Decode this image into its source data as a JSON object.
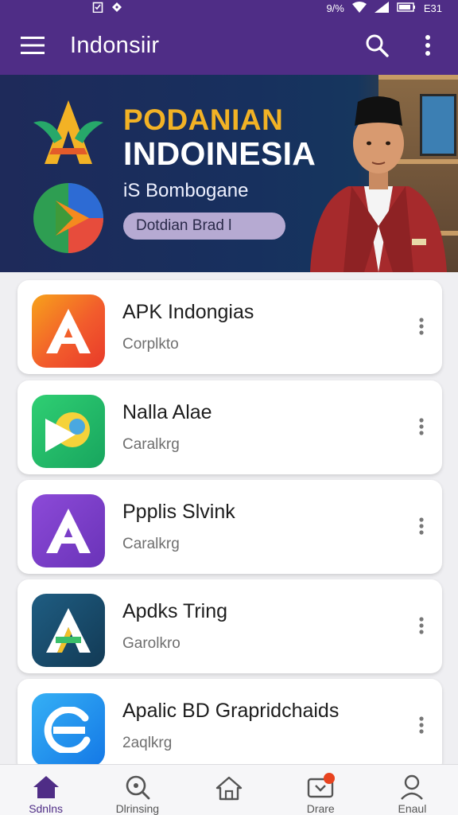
{
  "status_bar": {
    "left_icons": [
      "clipboard-icon",
      "tag-icon"
    ],
    "battery_text": "9/%",
    "time": "E31"
  },
  "app_bar": {
    "title": "Indonsiir",
    "icons": [
      "menu-icon",
      "search-icon",
      "more-vertical-icon"
    ]
  },
  "banner": {
    "heading_1": "PODANIAN",
    "heading_2": "INDOINESIA",
    "subtitle": "iS Bombogane",
    "cta_label": "Dotdian Brad l",
    "colors": {
      "heading_accent": "#f2b225",
      "background": "#1e2a5a"
    }
  },
  "apps": [
    {
      "title": "APK Indongias",
      "subtitle": "Corplkto",
      "icon": "letter-a-icon",
      "color": "#f25c2c"
    },
    {
      "title": "Nalla Alae",
      "subtitle": "Caralkrg",
      "icon": "play-leaf-icon",
      "color": "#1fb46a"
    },
    {
      "title": "Ppplis Slvink",
      "subtitle": "Caralkrg",
      "icon": "letter-a-icon",
      "color": "#7b3fc4"
    },
    {
      "title": "Apdks Tring",
      "subtitle": "Garolkro",
      "icon": "letter-a-icon",
      "color": "#1b4a6b"
    },
    {
      "title": "Apalic BD Grapridchaids",
      "subtitle": "2aqlkrg",
      "icon": "letter-e-icon",
      "color": "#1f8ef0"
    }
  ],
  "bottom_nav": [
    {
      "label": "Sdnlns",
      "icon": "home-filled-icon",
      "active": true
    },
    {
      "label": "Dlrinsing",
      "icon": "search-icon",
      "active": false
    },
    {
      "label": "",
      "icon": "home-outline-icon",
      "active": false
    },
    {
      "label": "Drare",
      "icon": "inbox-icon",
      "active": false,
      "badge": true
    },
    {
      "label": "Enaul",
      "icon": "profile-icon",
      "active": false
    }
  ],
  "theme": {
    "primary": "#4f2d86",
    "badge": "#e8431f"
  }
}
